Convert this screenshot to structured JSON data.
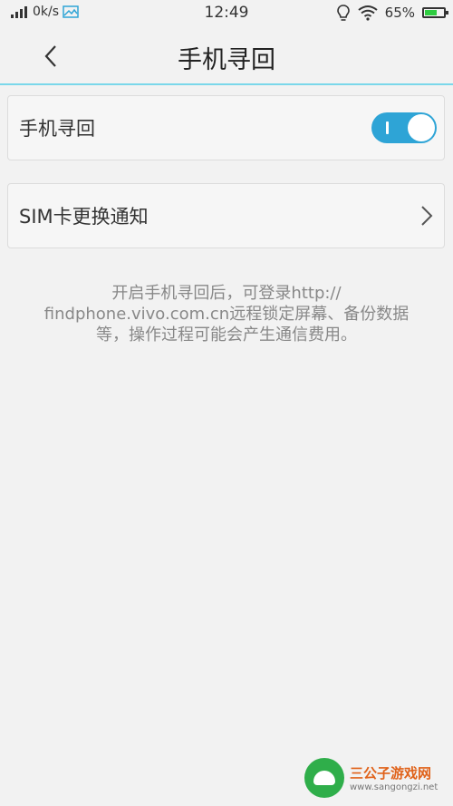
{
  "status_bar": {
    "speed": "0k/s",
    "time": "12:49",
    "battery": "65%",
    "battery_level": 0.65
  },
  "header": {
    "title": "手机寻回"
  },
  "settings": {
    "find_phone": {
      "label": "手机寻回",
      "enabled": true
    },
    "sim_notify": {
      "label": "SIM卡更换通知"
    }
  },
  "info": {
    "line1": "开启手机寻回后，可登录http://",
    "line2": "findphone.vivo.com.cn远程锁定屏幕、备份数据",
    "line3": "等，操作过程可能会产生通信费用。"
  },
  "watermark": {
    "title": "三公子游戏网",
    "url": "www.sangongzi.net"
  },
  "colors": {
    "accent": "#2ea4d6",
    "header_line": "#7ad7ea",
    "background": "#f2f2f2"
  }
}
